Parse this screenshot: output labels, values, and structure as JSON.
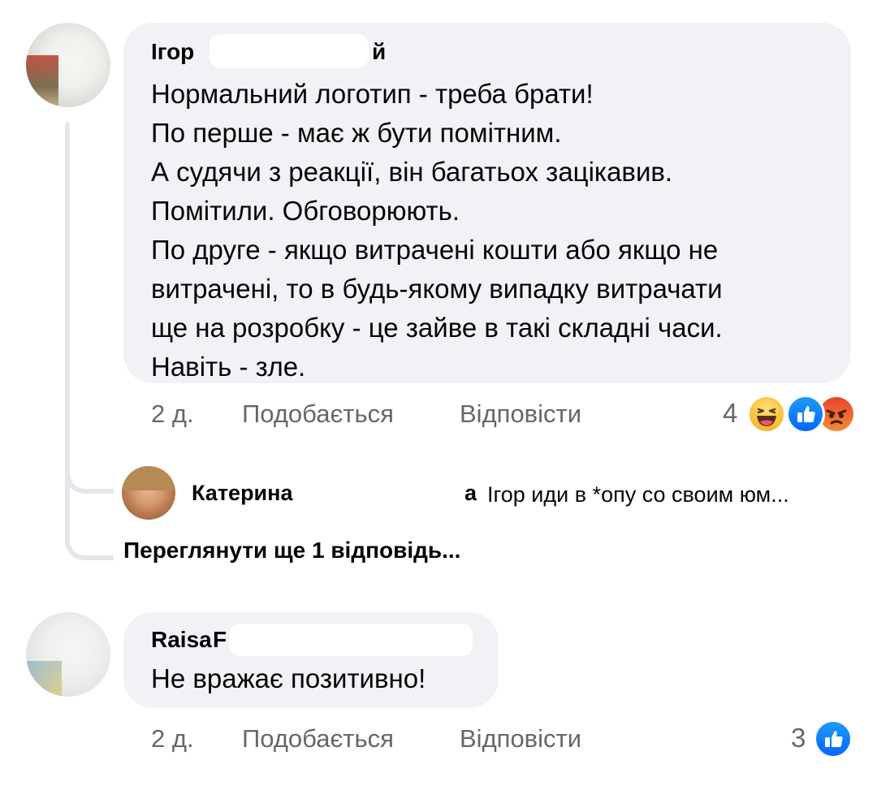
{
  "comments": [
    {
      "author": "Ігор",
      "author_suffix": "й",
      "text_lines": [
        "Нормальний логотип - треба брати!",
        "По перше - має ж бути помітним.",
        "А судячи з реакції, він багатьох зацікавив.",
        "Помітили. Обговорюють.",
        "По друге - якщо витрачені кошти або якщо не",
        "витрачені, то в будь-якому випадку витрачати",
        "ще на розробку - це зайве в такі складні часи.",
        "Навіть - зле."
      ],
      "time": "2 д.",
      "like_label": "Подобається",
      "reply_label": "Відповісти",
      "reaction_count": "4",
      "reactions": [
        "haha-emoji",
        "like-emoji",
        "angry-emoji"
      ]
    },
    {
      "author": "Raisa",
      "author_suffix": "F",
      "text_lines": [
        "Не вражає позитивно!"
      ],
      "time": "2 д.",
      "like_label": "Подобається",
      "reply_label": "Відповісти",
      "reaction_count": "3",
      "reactions": [
        "like-emoji"
      ]
    }
  ],
  "reply": {
    "author": "Катерина",
    "author_suffix": "а",
    "text": "Ігор иди в *опу со своим юм..."
  },
  "view_more": "Переглянути ще 1 відповідь..."
}
